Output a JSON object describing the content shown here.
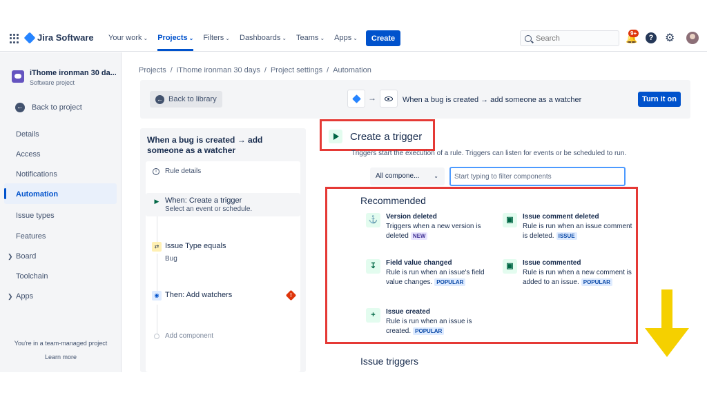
{
  "topnav": {
    "brand": "Jira Software",
    "links": [
      "Your work",
      "Projects",
      "Filters",
      "Dashboards",
      "Teams",
      "Apps"
    ],
    "active_link": "Projects",
    "create_label": "Create",
    "search_placeholder": "Search",
    "notification_count": "9+",
    "help_glyph": "?"
  },
  "sidebar": {
    "project_name": "iThome ironman 30 da...",
    "project_type": "Software project",
    "back_label": "Back to project",
    "items": [
      "Details",
      "Access",
      "Notifications",
      "Automation",
      "Issue types",
      "Features",
      "Board",
      "Toolchain",
      "Apps"
    ],
    "active_item": "Automation",
    "footer_note": "You're in a team-managed project",
    "learn_more": "Learn more"
  },
  "breadcrumb": [
    "Projects",
    "iThome ironman 30 days",
    "Project settings",
    "Automation"
  ],
  "toolbar": {
    "back_label": "Back to library",
    "rule_title": "When a bug is created → add someone as a watcher",
    "turn_on_label": "Turn it on"
  },
  "rule_panel": {
    "heading": "When a bug is created → add someone as a watcher",
    "details_label": "Rule details",
    "steps": [
      {
        "title": "When: Create a trigger",
        "subtitle": "Select an event or schedule."
      },
      {
        "title": "Issue Type equals",
        "subtitle": "Bug"
      },
      {
        "title": "Then: Add watchers",
        "subtitle": ""
      }
    ],
    "add_component": "Add component"
  },
  "trigger": {
    "title": "Create a trigger",
    "description": "Triggers start the execution of a rule. Triggers can listen for events or be scheduled to run.",
    "select_value": "All compone...",
    "filter_placeholder": "Start typing to filter components",
    "recommended_title": "Recommended",
    "cards": [
      {
        "title": "Version deleted",
        "desc": "Triggers when a new version is deleted",
        "badge": "NEW",
        "icon": "ship-icon"
      },
      {
        "title": "Issue comment deleted",
        "desc": "Rule is run when an issue comment is deleted.",
        "badge": "ISSUE",
        "icon": "comment-icon"
      },
      {
        "title": "Field value changed",
        "desc": "Rule is run when an issue's field value changes.",
        "badge": "POPULAR",
        "icon": "field-change-icon"
      },
      {
        "title": "Issue commented",
        "desc": "Rule is run when a new comment is added to an issue.",
        "badge": "POPULAR",
        "icon": "comment-icon"
      },
      {
        "title": "Issue created",
        "desc": "Rule is run when an issue is created.",
        "badge": "POPULAR",
        "icon": "plus-icon"
      }
    ],
    "issue_triggers_title": "Issue triggers"
  },
  "colors": {
    "accent": "#0052cc",
    "highlight_box": "#e53935",
    "arrow": "#f5d000"
  }
}
